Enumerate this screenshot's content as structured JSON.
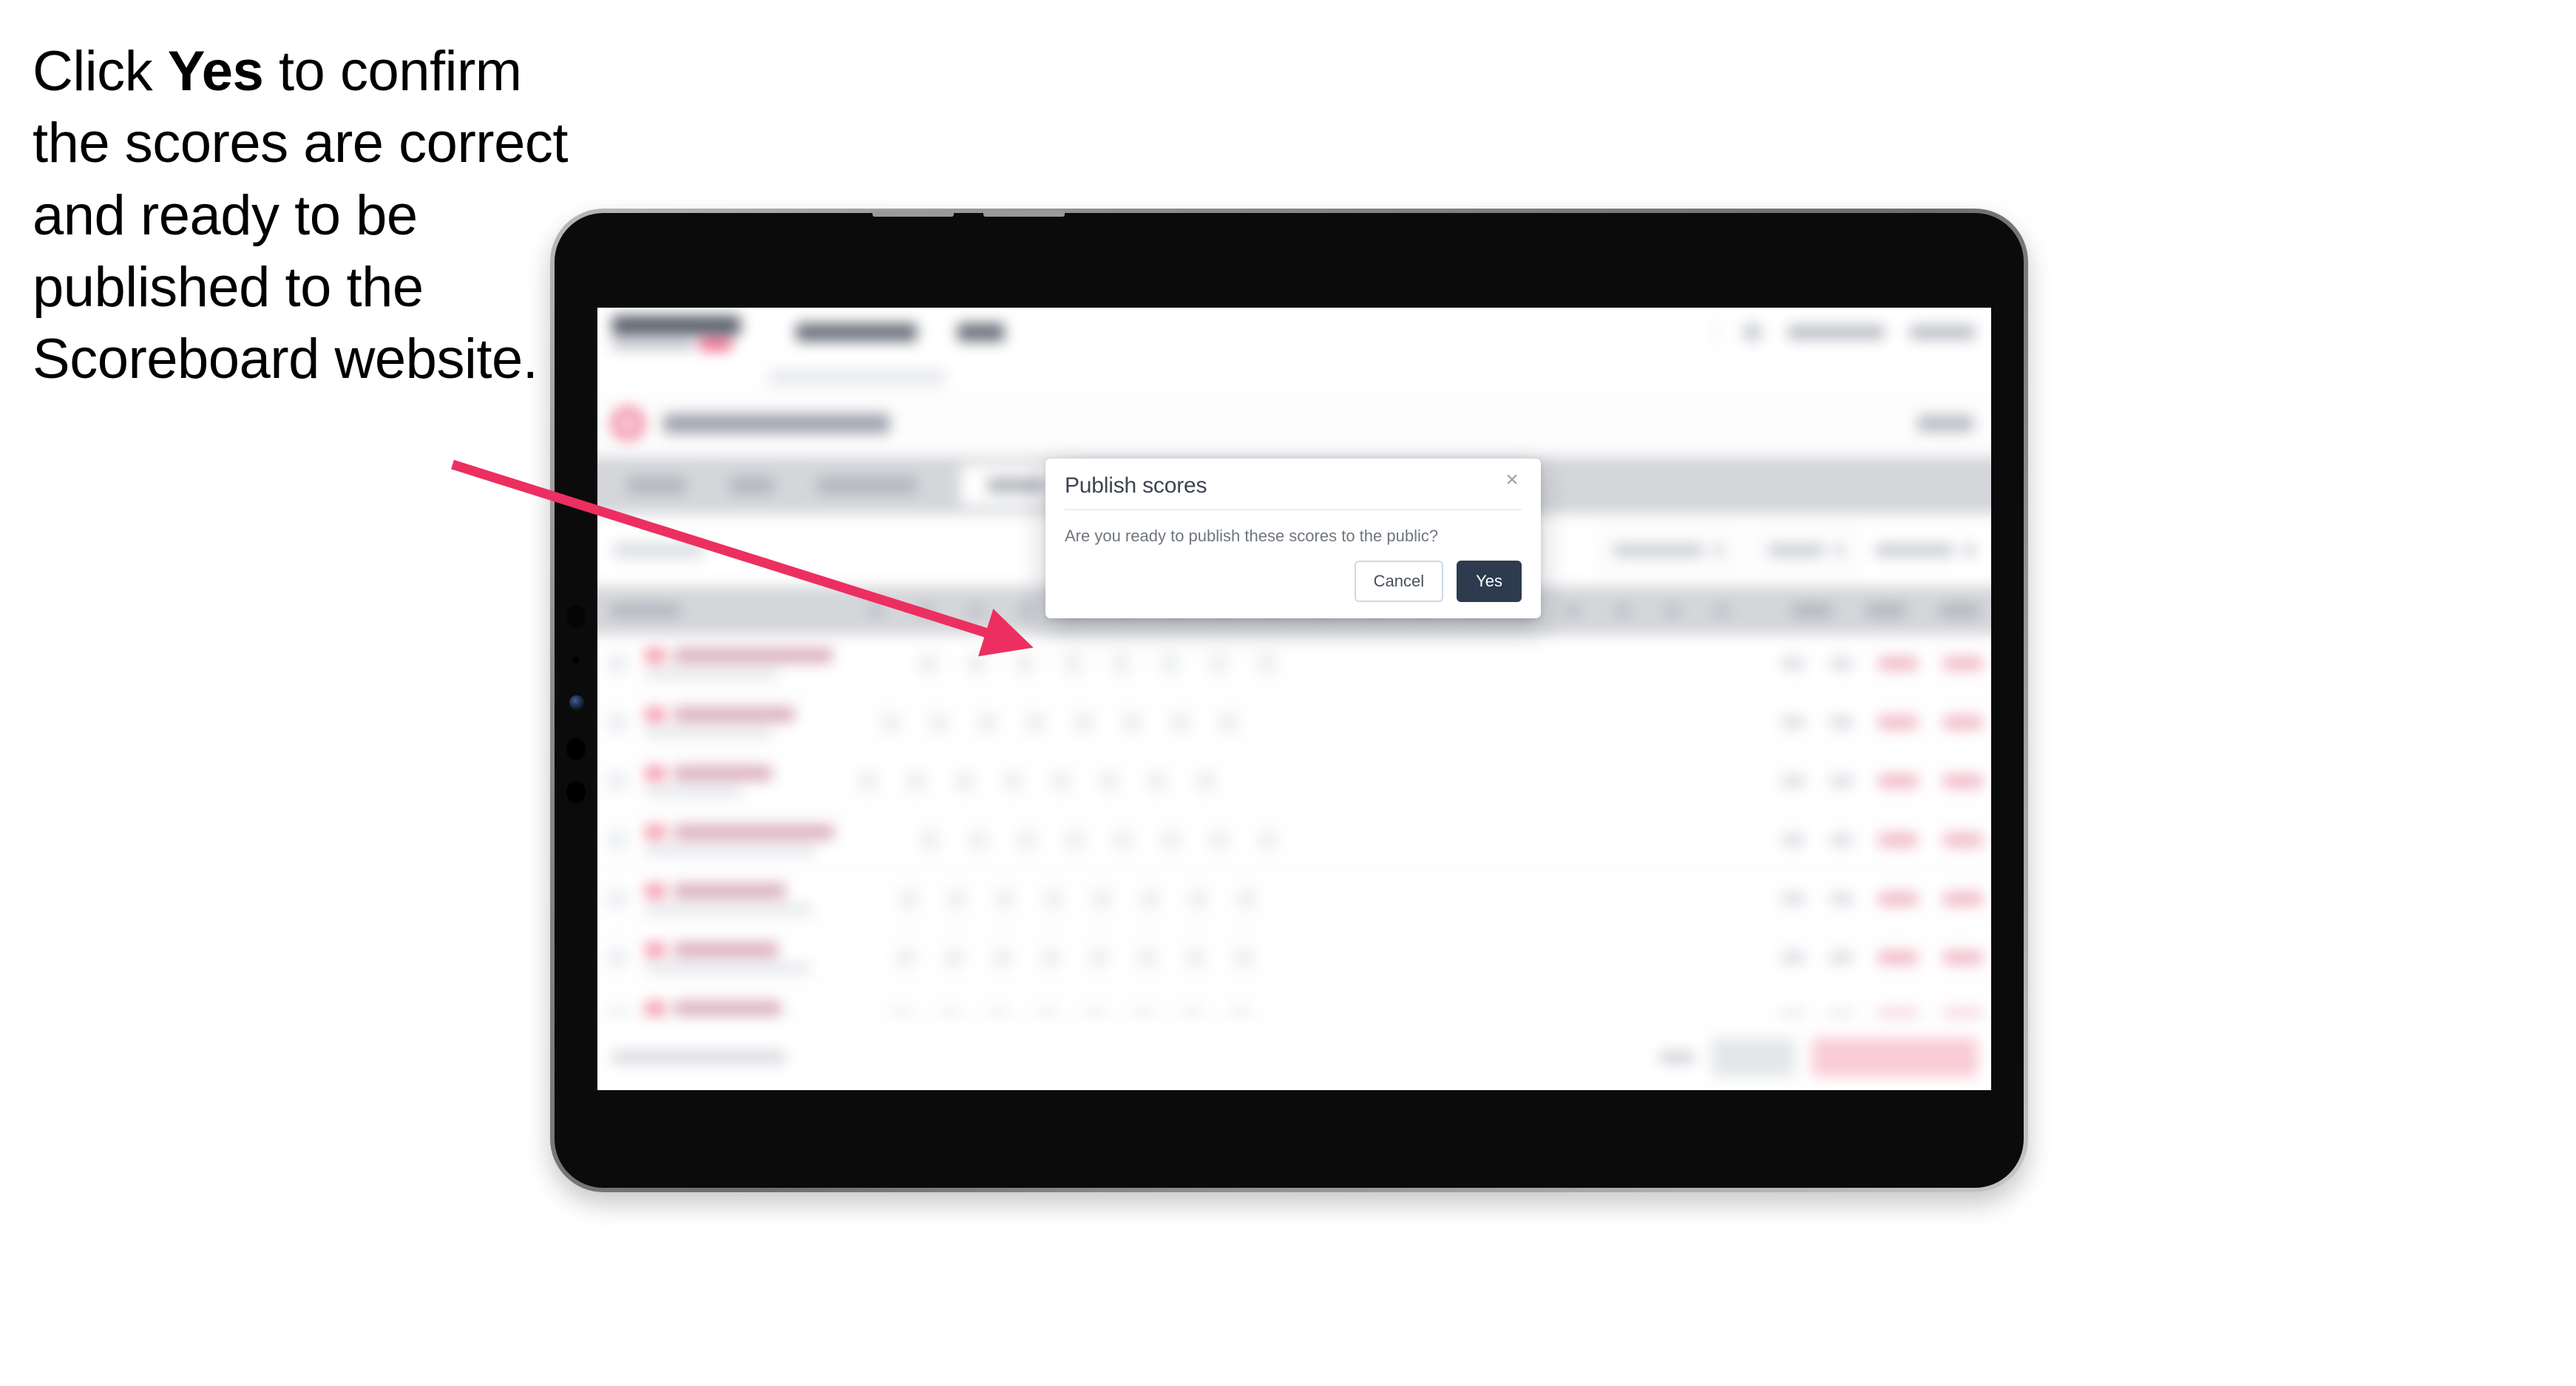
{
  "instruction": {
    "line_before": "Click ",
    "emphasis": "Yes",
    "line_after": " to confirm the scores are correct and ready to be published to the Scoreboard website."
  },
  "modal": {
    "title": "Publish scores",
    "body": "Are you ready to publish these scores to the public?",
    "close_icon": "×",
    "cancel_label": "Cancel",
    "confirm_label": "Yes"
  },
  "colors": {
    "arrow": "#ec2f60",
    "confirm_button_bg": "#2e3a4e",
    "cancel_border": "#ccd9e8",
    "modal_title": "#3d4450",
    "modal_body": "#70767f",
    "tab_bar_bg": "#d4d6da",
    "brand_pink": "#ee3a68",
    "device_frame": "#0b0b0b",
    "device_rim": "#8d8d8d"
  }
}
